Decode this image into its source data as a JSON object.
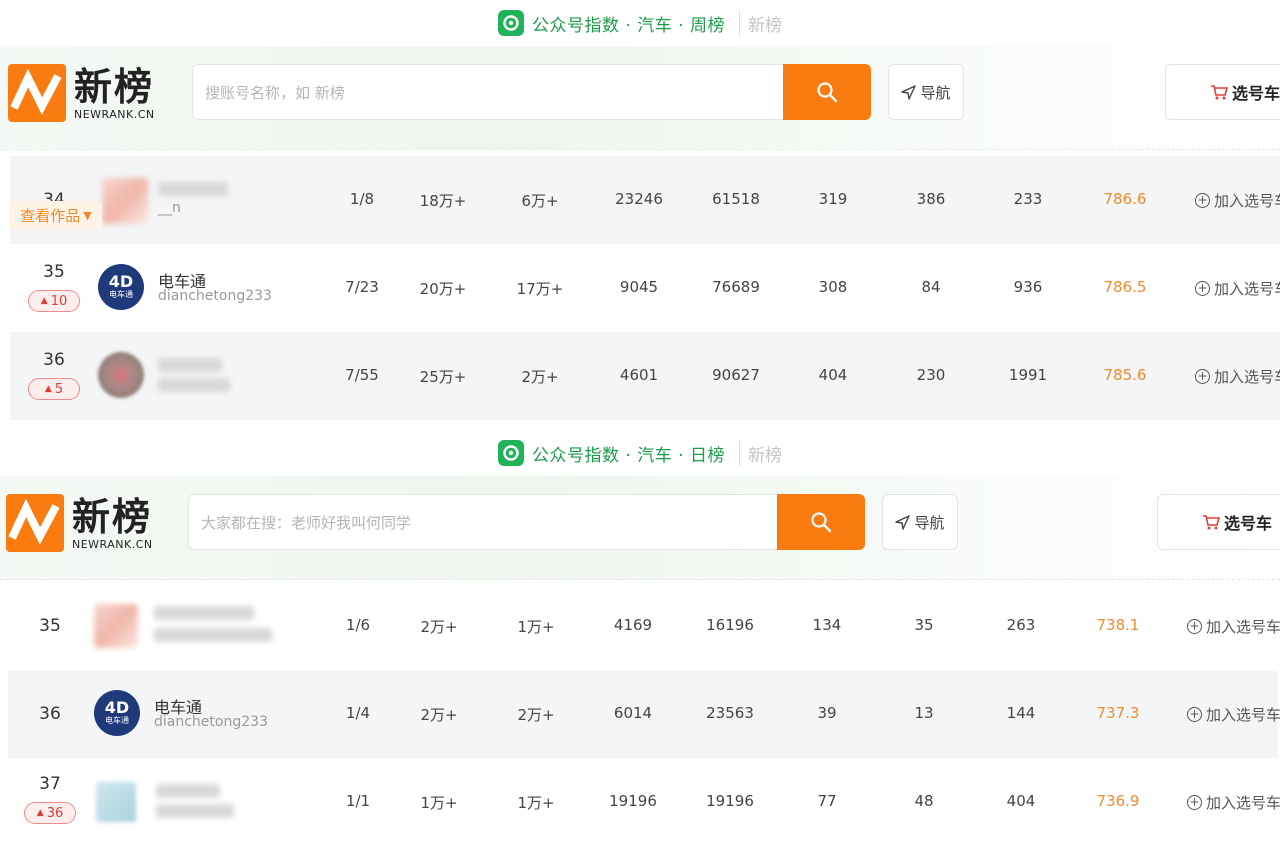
{
  "colors": {
    "accent": "#fa7b0f",
    "wechat_green": "#21b35a",
    "score": "#f08a2b",
    "up_badge": "#e23b3b"
  },
  "icons": {
    "wechat": "wechat-icon",
    "search": "search-icon",
    "nav": "navigation-arrow-icon",
    "cart": "cart-icon",
    "plus": "plus-circle-icon"
  },
  "panel1": {
    "title": "公众号指数 · 汽车 · 周榜",
    "title_brand": "新榜",
    "logo_cn": "新榜",
    "logo_en": "NEWRANK.CN",
    "search_placeholder": "搜账号名称，如 新榜",
    "nav_label": "导航",
    "cart_label": "选号车",
    "works_tag": "查看作品",
    "rows": [
      {
        "rank": "34",
        "name": "",
        "handle": "__n",
        "c1": "1/8",
        "c2": "18万+",
        "c3": "6万+",
        "c4": "23246",
        "c5": "61518",
        "c6": "319",
        "c7": "386",
        "c8": "233",
        "score": "786.6",
        "add": "加入选号车"
      },
      {
        "rank": "35",
        "badge": "10",
        "name": "电车通",
        "handle": "dianchetong233",
        "c1": "7/23",
        "c2": "20万+",
        "c3": "17万+",
        "c4": "9045",
        "c5": "76689",
        "c6": "308",
        "c7": "84",
        "c8": "936",
        "score": "786.5",
        "add": "加入选号车"
      },
      {
        "rank": "36",
        "badge": "5",
        "name": "",
        "handle": "",
        "c1": "7/55",
        "c2": "25万+",
        "c3": "2万+",
        "c4": "4601",
        "c5": "90627",
        "c6": "404",
        "c7": "230",
        "c8": "1991",
        "score": "785.6",
        "add": "加入选号车"
      }
    ]
  },
  "panel2": {
    "title": "公众号指数 · 汽车 · 日榜",
    "title_brand": "新榜",
    "logo_cn": "新榜",
    "logo_en": "NEWRANK.CN",
    "search_placeholder": "大家都在搜：老师好我叫何同学",
    "nav_label": "导航",
    "cart_label": "选号车",
    "rows": [
      {
        "rank": "35",
        "name": "",
        "handle": "",
        "c1": "1/6",
        "c2": "2万+",
        "c3": "1万+",
        "c4": "4169",
        "c5": "16196",
        "c6": "134",
        "c7": "35",
        "c8": "263",
        "score": "738.1",
        "add": "加入选号车"
      },
      {
        "rank": "36",
        "name": "电车通",
        "handle": "dianchetong233",
        "c1": "1/4",
        "c2": "2万+",
        "c3": "2万+",
        "c4": "6014",
        "c5": "23563",
        "c6": "39",
        "c7": "13",
        "c8": "144",
        "score": "737.3",
        "add": "加入选号车"
      },
      {
        "rank": "37",
        "badge": "36",
        "name": "",
        "handle": "",
        "c1": "1/1",
        "c2": "1万+",
        "c3": "1万+",
        "c4": "19196",
        "c5": "19196",
        "c6": "77",
        "c7": "48",
        "c8": "404",
        "score": "736.9",
        "add": "加入选号车"
      }
    ]
  },
  "avatar_brand_text": {
    "glyph": "4D",
    "small": "电车通"
  }
}
